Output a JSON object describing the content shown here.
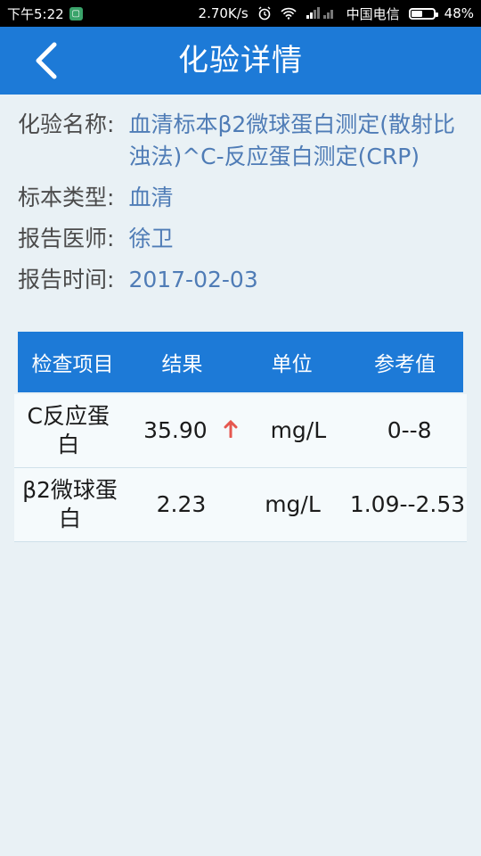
{
  "status_bar": {
    "time": "下午5:22",
    "speed": "2.70K/s",
    "carrier": "中国电信",
    "battery_percent": "48%",
    "battery_level": 0.48
  },
  "header": {
    "title": "化验详情"
  },
  "info": {
    "name_label": "化验名称:",
    "name_value": "血清标本β2微球蛋白测定(散射比浊法)^C-反应蛋白测定(CRP)",
    "type_label": "标本类型:",
    "type_value": "血清",
    "doctor_label": "报告医师:",
    "doctor_value": "徐卫",
    "time_label": "报告时间:",
    "time_value": "2017-02-03"
  },
  "table": {
    "headers": [
      "检查项目",
      "结果",
      "单位",
      "参考值"
    ],
    "rows": [
      {
        "item": "C反应蛋白",
        "result": "35.90",
        "flag": "up-arrow",
        "unit": "mg/L",
        "ref": "0--8"
      },
      {
        "item": "β2微球蛋白",
        "result": "2.23",
        "flag": "",
        "unit": "mg/L",
        "ref": "1.09--2.53"
      }
    ]
  },
  "colors": {
    "primary": "#1d7ad7",
    "background": "#e9f1f5",
    "value_text": "#4f7cb6",
    "alert_arrow": "#e5574f"
  }
}
